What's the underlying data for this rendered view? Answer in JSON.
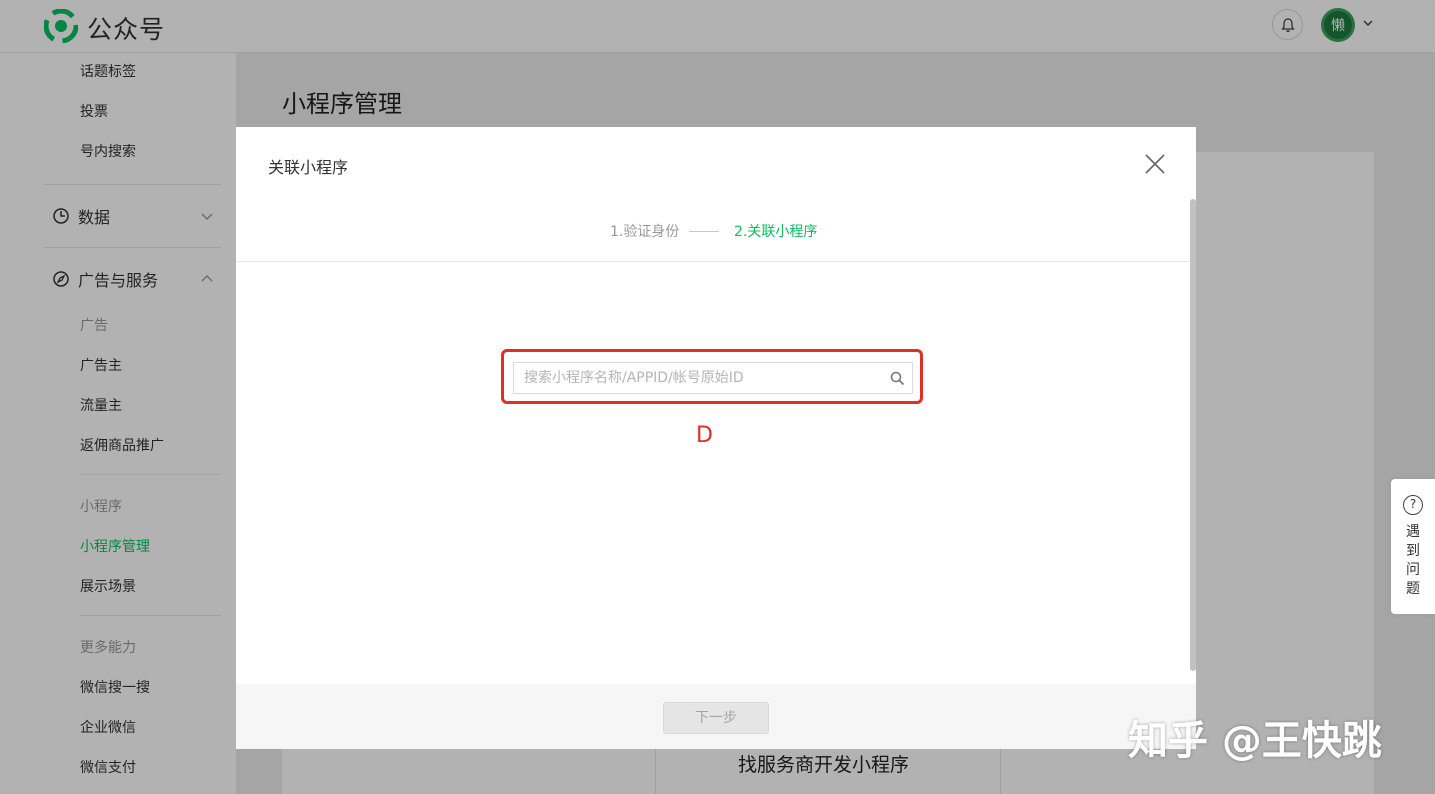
{
  "app": {
    "logo_text": "公众号",
    "avatar_char": "懒"
  },
  "sidebar": {
    "top_items": [
      {
        "label": "话题标签"
      },
      {
        "label": "投票"
      },
      {
        "label": "号内搜索"
      }
    ],
    "data_section": {
      "label": "数据"
    },
    "ads_section": {
      "label": "广告与服务"
    },
    "ads_group": {
      "label": "广告"
    },
    "ads_items": [
      {
        "label": "广告主"
      },
      {
        "label": "流量主"
      },
      {
        "label": "返佣商品推广"
      }
    ],
    "mini_group": {
      "label": "小程序"
    },
    "mini_items": [
      {
        "label": "小程序管理",
        "active": true
      },
      {
        "label": "展示场景"
      }
    ],
    "more_group": {
      "label": "更多能力"
    },
    "more_items": [
      {
        "label": "微信搜一搜"
      },
      {
        "label": "企业微信"
      },
      {
        "label": "微信支付"
      }
    ]
  },
  "main": {
    "page_title": "小程序管理",
    "bottom_card_title": "找服务商开发小程序"
  },
  "help": {
    "label": "遇到问题"
  },
  "dialog": {
    "title": "关联小程序",
    "steps": [
      {
        "label": "1.验证身份",
        "state": "done"
      },
      {
        "label": "2.关联小程序",
        "state": "active"
      }
    ],
    "search": {
      "placeholder": "搜索小程序名称/APPID/帐号原始ID",
      "value": ""
    },
    "annotation": "D",
    "next_button": "下一步"
  },
  "watermark": "知乎 @王快跳",
  "colors": {
    "accent": "#07c160",
    "highlight": "#e02f23"
  }
}
